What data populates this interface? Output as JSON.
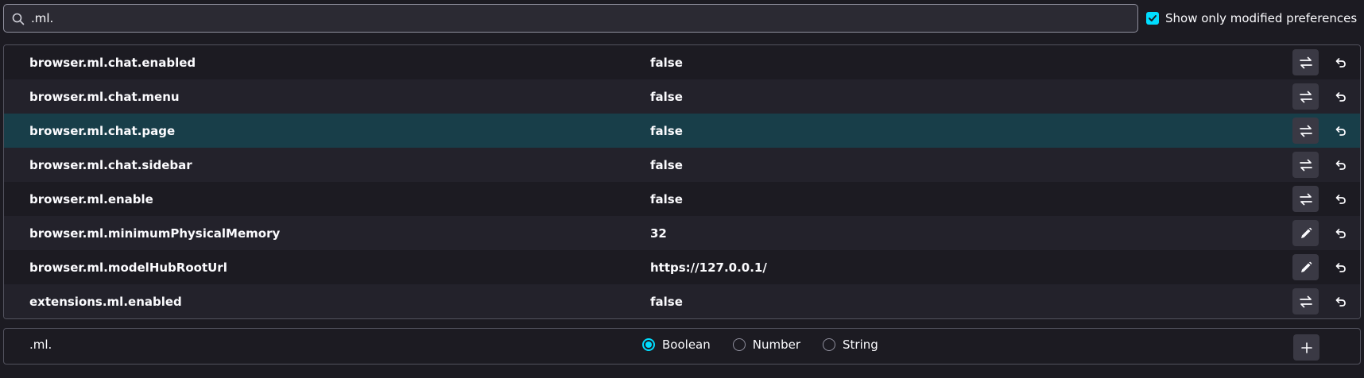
{
  "search": {
    "value": ".ml.",
    "icon": "search-icon"
  },
  "filter": {
    "label": "Show only modified preferences",
    "checked": true,
    "accent": "#00ddff"
  },
  "prefs": [
    {
      "name": "browser.ml.chat.enabled",
      "value": "false",
      "action": "toggle-icon"
    },
    {
      "name": "browser.ml.chat.menu",
      "value": "false",
      "action": "toggle-icon"
    },
    {
      "name": "browser.ml.chat.page",
      "value": "false",
      "action": "toggle-icon",
      "selected": true
    },
    {
      "name": "browser.ml.chat.sidebar",
      "value": "false",
      "action": "toggle-icon"
    },
    {
      "name": "browser.ml.enable",
      "value": "false",
      "action": "toggle-icon"
    },
    {
      "name": "browser.ml.minimumPhysicalMemory",
      "value": "32",
      "action": "edit-icon"
    },
    {
      "name": "browser.ml.modelHubRootUrl",
      "value": "https://127.0.0.1/",
      "action": "edit-icon"
    },
    {
      "name": "extensions.ml.enabled",
      "value": "false",
      "action": "toggle-icon"
    }
  ],
  "add_pref": {
    "name": ".ml.",
    "types": [
      {
        "label": "Boolean",
        "checked": true
      },
      {
        "label": "Number",
        "checked": false
      },
      {
        "label": "String",
        "checked": false
      }
    ],
    "add_icon": "plus-icon"
  },
  "colors": {
    "background": "#1c1b22",
    "row_alt": "#23222b",
    "row_selected": "#183e49",
    "accent": "#00ddff"
  }
}
